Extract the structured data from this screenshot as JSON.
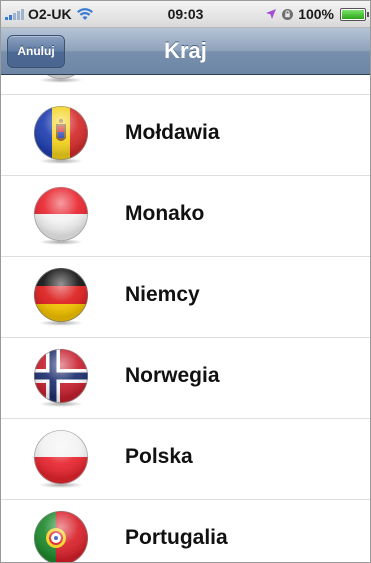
{
  "status_bar": {
    "carrier": "O2-UK",
    "time": "09:03",
    "battery": "100%",
    "battery_level": 1.0,
    "signal_bars": 2
  },
  "nav": {
    "cancel_label": "Anuluj",
    "title": "Kraj"
  },
  "countries": [
    {
      "name": "",
      "flag": "partial-flag-icon"
    },
    {
      "name": "Mołdawia",
      "flag": "moldova-flag-icon"
    },
    {
      "name": "Monako",
      "flag": "monaco-flag-icon"
    },
    {
      "name": "Niemcy",
      "flag": "germany-flag-icon"
    },
    {
      "name": "Norwegia",
      "flag": "norway-flag-icon"
    },
    {
      "name": "Polska",
      "flag": "poland-flag-icon"
    },
    {
      "name": "Portugalia",
      "flag": "portugal-flag-icon"
    }
  ],
  "colors": {
    "nav_blue": "#7890ad",
    "signal_blue": "#3b7bd1",
    "battery_green": "#2ea51c",
    "location_purple": "#a64fd6"
  }
}
